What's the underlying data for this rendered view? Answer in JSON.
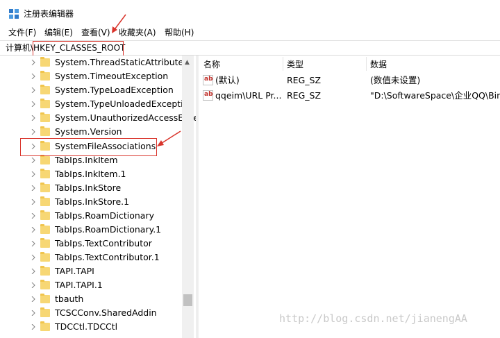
{
  "window": {
    "title": "注册表编辑器",
    "icon": "registry-editor-icon"
  },
  "menu": [
    {
      "label": "文件(F)"
    },
    {
      "label": "编辑(E)"
    },
    {
      "label": "查看(V)"
    },
    {
      "label": "收藏夹(A)"
    },
    {
      "label": "帮助(H)"
    }
  ],
  "address": {
    "path": "计算机\\HKEY_CLASSES_ROOT"
  },
  "tree": {
    "items": [
      {
        "label": "System.ThreadStaticAttribute"
      },
      {
        "label": "System.TimeoutException"
      },
      {
        "label": "System.TypeLoadException"
      },
      {
        "label": "System.TypeUnloadedException"
      },
      {
        "label": "System.UnauthorizedAccessException"
      },
      {
        "label": "System.Version"
      },
      {
        "label": "SystemFileAssociations"
      },
      {
        "label": "TabIps.InkItem"
      },
      {
        "label": "TabIps.InkItem.1"
      },
      {
        "label": "TabIps.InkStore"
      },
      {
        "label": "TabIps.InkStore.1"
      },
      {
        "label": "TabIps.RoamDictionary"
      },
      {
        "label": "TabIps.RoamDictionary.1"
      },
      {
        "label": "TabIps.TextContributor"
      },
      {
        "label": "TabIps.TextContributor.1"
      },
      {
        "label": "TAPI.TAPI"
      },
      {
        "label": "TAPI.TAPI.1"
      },
      {
        "label": "tbauth"
      },
      {
        "label": "TCSCConv.SharedAddin"
      },
      {
        "label": "TDCCtl.TDCCtl"
      }
    ]
  },
  "list": {
    "columns": {
      "name": "名称",
      "type": "类型",
      "data": "数据"
    },
    "rows": [
      {
        "name": "(默认)",
        "type": "REG_SZ",
        "data": "(数值未设置)"
      },
      {
        "name": "qqeim\\URL Pr...",
        "type": "REG_SZ",
        "data": "\"D:\\SoftwareSpace\\企业QQ\\Bin\\"
      }
    ]
  },
  "watermark": "http://blog.csdn.net/jianengAA",
  "colors": {
    "annotation": "#d9342b",
    "folder": "#f7d774"
  }
}
